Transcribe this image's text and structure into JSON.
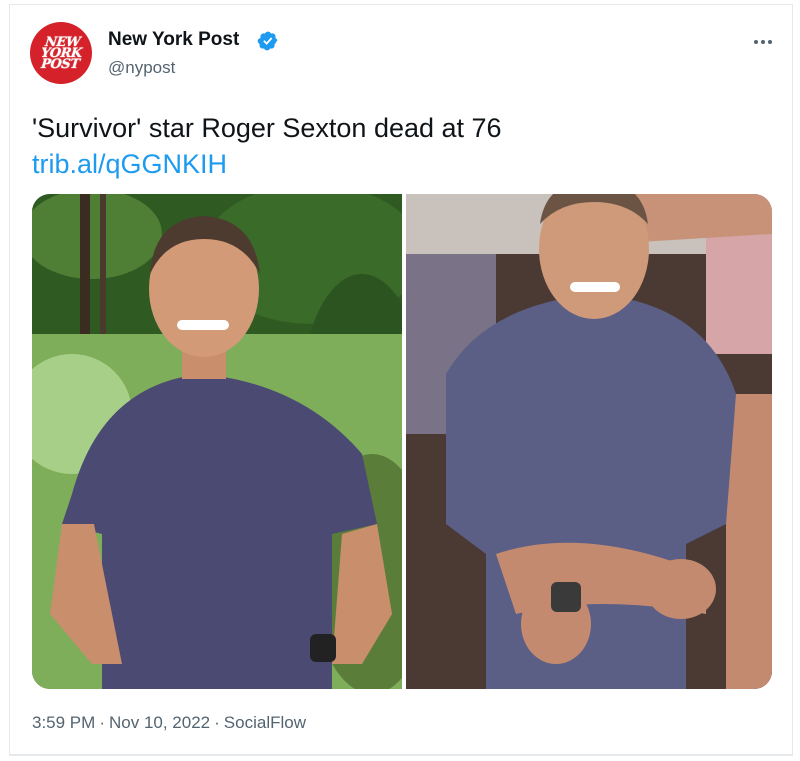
{
  "author": {
    "name": "New York Post",
    "handle": "@nypost",
    "avatar_text": "NEW YORK POST",
    "verified": true,
    "brand_color": "#d5222a",
    "verified_color": "#1d9bf0"
  },
  "tweet": {
    "text": "'Survivor' star Roger Sexton dead at 76",
    "link": "trib.al/qGGNKIH",
    "time": "3:59 PM",
    "date": "Nov 10, 2022",
    "source": "SocialFlow",
    "separator": "·"
  },
  "media": {
    "photos": [
      {
        "name": "photo-left",
        "description_icon": "portrait-photo"
      },
      {
        "name": "photo-right",
        "description_icon": "portrait-photo"
      }
    ]
  },
  "colors": {
    "link": "#1d9bf0",
    "secondary_text": "#536471",
    "primary_text": "#0f1419"
  }
}
